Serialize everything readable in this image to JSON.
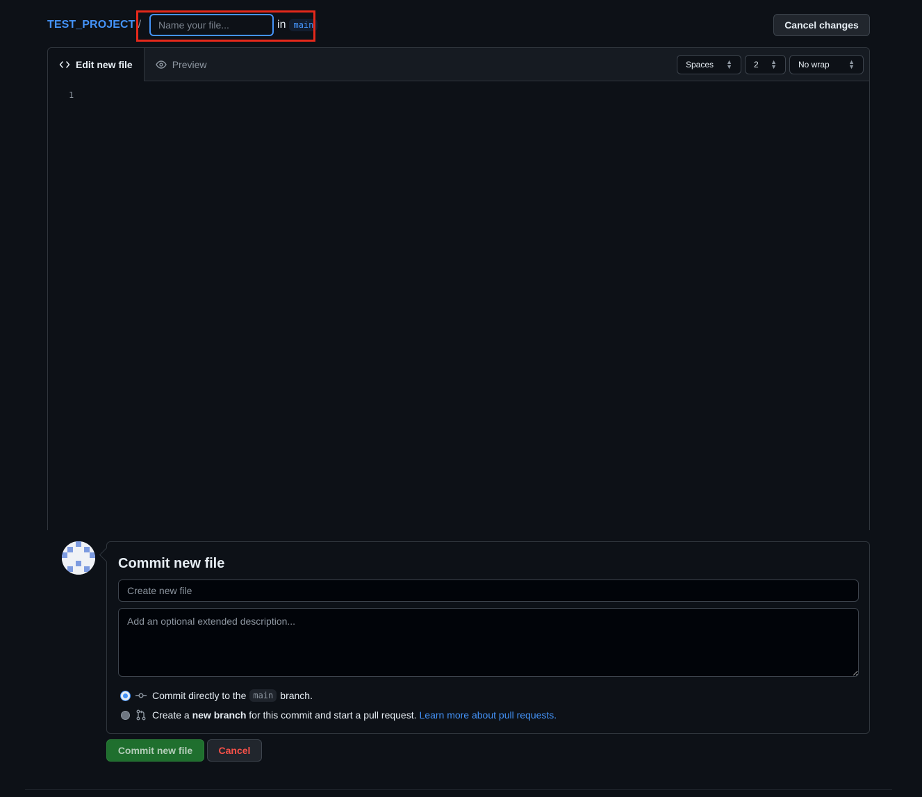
{
  "header": {
    "repo_name": "TEST_PROJECT",
    "separator": "/",
    "filename_placeholder": "Name your file...",
    "in_label": "in",
    "branch": "main",
    "cancel_changes_label": "Cancel changes"
  },
  "editor": {
    "tabs": [
      {
        "label": "Edit new file",
        "icon": "code-icon",
        "active": true
      },
      {
        "label": "Preview",
        "icon": "eye-icon",
        "active": false
      }
    ],
    "indent_mode": "Spaces",
    "indent_size": "2",
    "wrap_mode": "No wrap",
    "line_numbers": [
      "1"
    ]
  },
  "commit": {
    "title": "Commit new file",
    "summary_placeholder": "Create new file",
    "description_placeholder": "Add an optional extended description...",
    "option_direct": {
      "prefix": "Commit directly to the",
      "branch": "main",
      "suffix": "branch.",
      "selected": true
    },
    "option_new_branch": {
      "prefix": "Create a",
      "bold": "new branch",
      "suffix": "for this commit and start a pull request.",
      "link": "Learn more about pull requests.",
      "selected": false
    },
    "commit_button_label": "Commit new file",
    "cancel_button_label": "Cancel"
  },
  "colors": {
    "background": "#0d1117",
    "accent": "#4493f8",
    "highlight_box": "#e5291b",
    "commit_button": "#1f6f2e",
    "danger": "#f85149"
  }
}
